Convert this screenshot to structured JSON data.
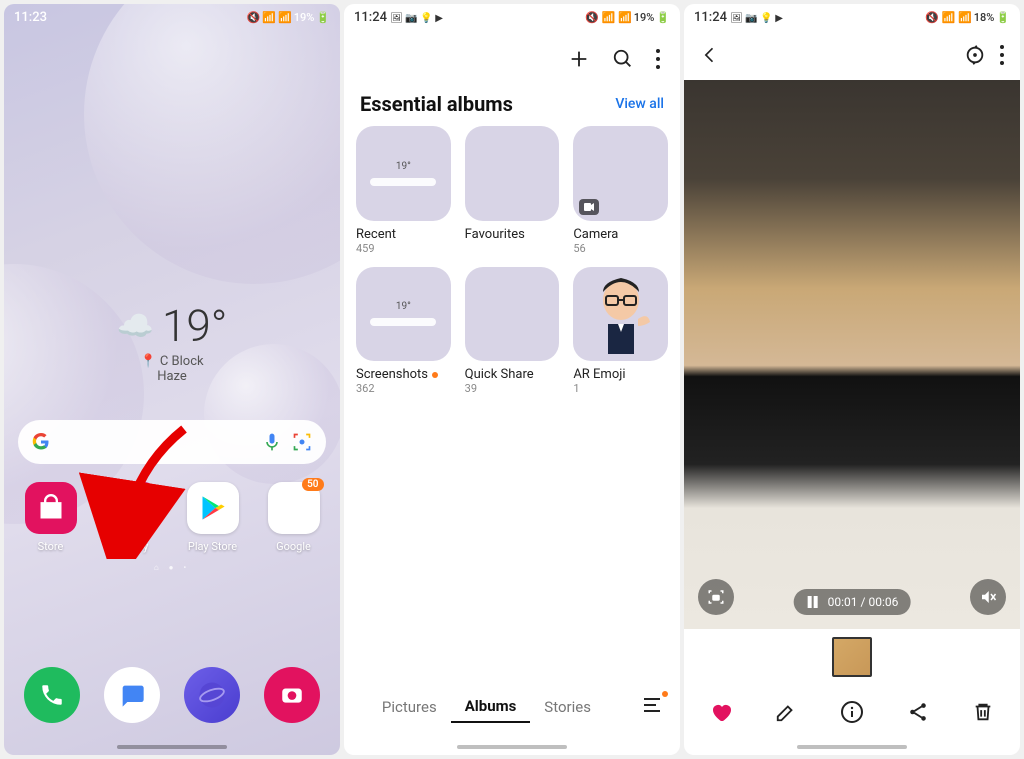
{
  "panel1": {
    "status": {
      "time": "11:23",
      "battery": "19%"
    },
    "weather": {
      "temp": "19°",
      "location": "C Block",
      "condition": "Haze",
      "loc_icon": "📍"
    },
    "apps": [
      {
        "name": "Store"
      },
      {
        "name": "Gallery"
      },
      {
        "name": "Play Store"
      },
      {
        "name": "Google",
        "badge": "50"
      }
    ]
  },
  "panel2": {
    "status": {
      "time": "11:24",
      "battery": "19%"
    },
    "section_title": "Essential albums",
    "view_all": "View all",
    "albums": [
      {
        "name": "Recent",
        "count": "459"
      },
      {
        "name": "Favourites",
        "count": ""
      },
      {
        "name": "Camera",
        "count": "56"
      },
      {
        "name": "Screenshots",
        "count": "362",
        "new": true
      },
      {
        "name": "Quick Share",
        "count": "39"
      },
      {
        "name": "AR Emoji",
        "count": "1"
      }
    ],
    "tabs": {
      "pictures": "Pictures",
      "albums": "Albums",
      "stories": "Stories"
    }
  },
  "panel3": {
    "status": {
      "time": "11:24",
      "battery": "18%"
    },
    "playback": {
      "current": "00:01",
      "total": "00:06",
      "sep": " / "
    }
  }
}
